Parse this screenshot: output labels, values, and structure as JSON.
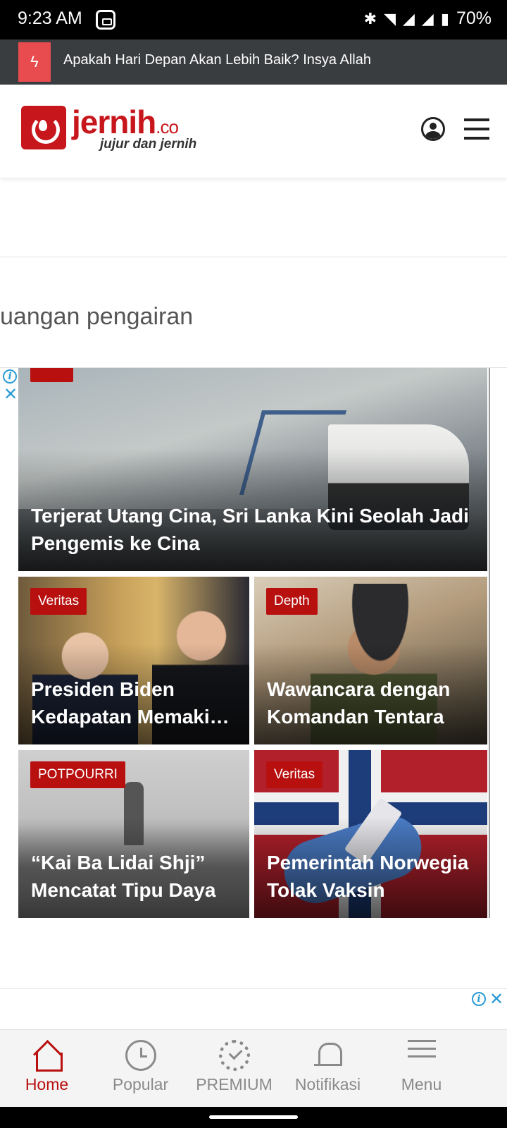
{
  "status_bar": {
    "time": "9:23 AM",
    "battery": "70%",
    "icons": [
      "app-notification-icon",
      "bluetooth-icon",
      "wifi-icon",
      "signal-icon",
      "signal-icon",
      "battery-icon"
    ]
  },
  "ticker": {
    "icon": "flash-icon",
    "text": "Apakah Hari Depan Akan Lebih Baik? Insya Allah"
  },
  "header": {
    "logo_name": "jernih",
    "logo_suffix": ".co",
    "tagline": "jujur dan jernih",
    "brand_color": "#c8161d"
  },
  "section": {
    "heading": "uangan pengairan"
  },
  "articles": {
    "hero": {
      "title": "Terjerat Utang Cina, Sri Lanka Kini Seolah Jadi Pengemis ke Cina"
    },
    "grid": [
      {
        "badge": "Veritas",
        "title": "Presiden Biden Kedapatan Memaki Wartawan"
      },
      {
        "badge": "Depth",
        "title": "Wawancara dengan Komandan Tentara"
      },
      {
        "badge": "POTPOURRI",
        "title": "“Kai Ba Lidai Shji” Mencatat Tipu Daya"
      },
      {
        "badge": "Veritas",
        "title": "Pemerintah Norwegia Tolak Vaksin"
      }
    ]
  },
  "bottom_nav": {
    "items": [
      {
        "label": "Home",
        "icon": "home-icon",
        "active": true
      },
      {
        "label": "Popular",
        "icon": "clock-icon",
        "active": false
      },
      {
        "label": "PREMIUM",
        "icon": "badge-check-icon",
        "active": false
      },
      {
        "label": "Notifikasi",
        "icon": "bell-icon",
        "active": false
      },
      {
        "label": "Menu",
        "icon": "menu-lines-icon",
        "active": false
      }
    ],
    "active_color": "#b7100f"
  },
  "ad": {
    "info_glyph": "i",
    "close_glyph": "✕"
  }
}
